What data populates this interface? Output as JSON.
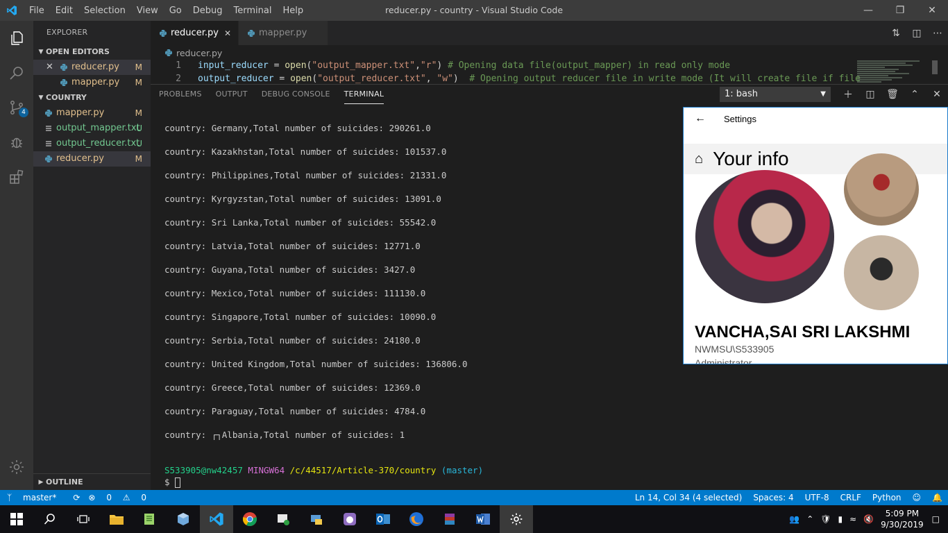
{
  "window": {
    "title": "reducer.py - country - Visual Studio Code",
    "menu": [
      "File",
      "Edit",
      "Selection",
      "View",
      "Go",
      "Debug",
      "Terminal",
      "Help"
    ]
  },
  "activity": {
    "scm_badge": "4"
  },
  "sidebar": {
    "title": "EXPLORER",
    "open_editors_label": "OPEN EDITORS",
    "open_editors": [
      {
        "name": "reducer.py",
        "status": "M"
      },
      {
        "name": "mapper.py",
        "status": "M"
      }
    ],
    "folder_label": "COUNTRY",
    "files": [
      {
        "name": "mapper.py",
        "status": "M"
      },
      {
        "name": "output_mapper.txt",
        "status": "U"
      },
      {
        "name": "output_reducer.txt",
        "status": "U"
      },
      {
        "name": "reducer.py",
        "status": "M"
      }
    ],
    "outline_label": "OUTLINE"
  },
  "tabs": [
    {
      "label": "reducer.py"
    },
    {
      "label": "mapper.py"
    }
  ],
  "breadcrumb": "reducer.py",
  "editor": {
    "line1_no": "1",
    "line2_no": "2",
    "l1_var": "input_reducer",
    "l1_eq": " = ",
    "l1_fn": "open",
    "l1_args_open": "(",
    "l1_str1": "\"output_mapper.txt\"",
    "l1_comma": ",",
    "l1_str2": "\"r\"",
    "l1_close": ") ",
    "l1_comment": "# Opening data file(output_mapper) in read only mode",
    "l2_var": "output_reducer",
    "l2_eq": " = ",
    "l2_fn": "open",
    "l2_args_open": "(",
    "l2_str1": "\"output_reducer.txt\"",
    "l2_comma": ", ",
    "l2_str2": "\"w\"",
    "l2_close": ")  ",
    "l2_comment": "# Opening output reducer file in write mode (It will create file if file"
  },
  "panel": {
    "tabs": [
      "PROBLEMS",
      "OUTPUT",
      "DEBUG CONSOLE",
      "TERMINAL"
    ],
    "terminal_select": "1: bash"
  },
  "terminal": {
    "lines": [
      "country: Germany,Total number of suicides: 290261.0",
      "country: Kazakhstan,Total number of suicides: 101537.0",
      "country: Philippines,Total number of suicides: 21331.0",
      "country: Kyrgyzstan,Total number of suicides: 13091.0",
      "country: Sri Lanka,Total number of suicides: 55542.0",
      "country: Latvia,Total number of suicides: 12771.0",
      "country: Guyana,Total number of suicides: 3427.0",
      "country: Mexico,Total number of suicides: 111130.0",
      "country: Singapore,Total number of suicides: 10090.0",
      "country: Serbia,Total number of suicides: 24180.0",
      "country: United Kingdom,Total number of suicides: 136806.0",
      "country: Greece,Total number of suicides: 12369.0",
      "country: Paraguay,Total number of suicides: 4784.0",
      "country: ┌┐Albania,Total number of suicides: 1"
    ],
    "prompt_user": "S533905@nw42457",
    "prompt_env": "MINGW64",
    "prompt_path": "/c/44517/Article-370/country",
    "prompt_branch": "(master)",
    "prompt_symbol": "$"
  },
  "settings": {
    "app_title": "Settings",
    "heading": "Your info",
    "name": "VANCHA,SAI SRI LAKSHMI",
    "account": "NWMSU\\S533905",
    "role": "Administrator"
  },
  "statusbar": {
    "branch": "master*",
    "errors": "0",
    "warnings": "0",
    "position": "Ln 14, Col 34 (4 selected)",
    "spaces": "Spaces: 4",
    "encoding": "UTF-8",
    "eol": "CRLF",
    "language": "Python"
  },
  "taskbar": {
    "time": "5:09 PM",
    "date": "9/30/2019"
  },
  "colors": {
    "accent": "#007acc",
    "modified": "#e2c08d",
    "untracked": "#73c991"
  }
}
